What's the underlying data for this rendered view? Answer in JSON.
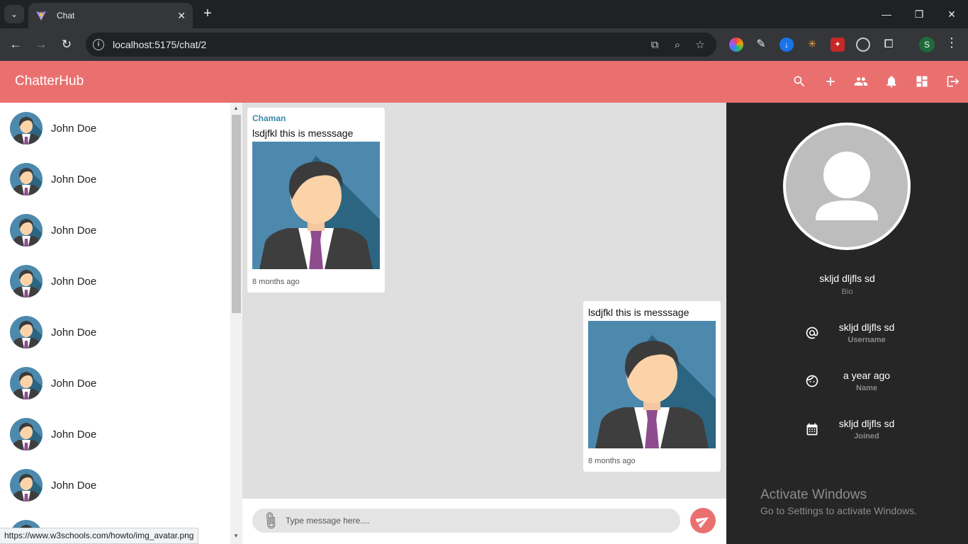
{
  "browser": {
    "tab_title": "Chat",
    "url": "localhost:5175/chat/2",
    "profile_initial": "S",
    "status_url": "https://www.w3schools.com/howto/img_avatar.png"
  },
  "app": {
    "brand": "ChatterHub",
    "accent": "#ea7070",
    "toolbar_icons": [
      "search-icon",
      "add-icon",
      "group-icon",
      "notifications-icon",
      "dashboard-icon",
      "logout-icon"
    ]
  },
  "sidebar": {
    "chats": [
      {
        "name": "John Doe"
      },
      {
        "name": "John Doe"
      },
      {
        "name": "John Doe"
      },
      {
        "name": "John Doe"
      },
      {
        "name": "John Doe"
      },
      {
        "name": "John Doe"
      },
      {
        "name": "John Doe"
      },
      {
        "name": "John Doe"
      }
    ]
  },
  "messages": [
    {
      "sender": "Chaman",
      "text": "lsdjfkl this is messsage",
      "time": "8 months ago",
      "side": "left"
    },
    {
      "sender": "",
      "text": "lsdjfkl this is messsage",
      "time": "8 months ago",
      "side": "right"
    }
  ],
  "composer": {
    "placeholder": "Type message here...."
  },
  "profile": {
    "bio_value": "skljd dljfls sd",
    "bio_label": "Bio",
    "username_value": "skljd dljfls sd",
    "username_label": "Username",
    "name_value": "a year ago",
    "name_label": "Name",
    "joined_value": "skljd dljfls sd",
    "joined_label": "Joined"
  },
  "watermark": {
    "line1": "Activate Windows",
    "line2": "Go to Settings to activate Windows."
  }
}
